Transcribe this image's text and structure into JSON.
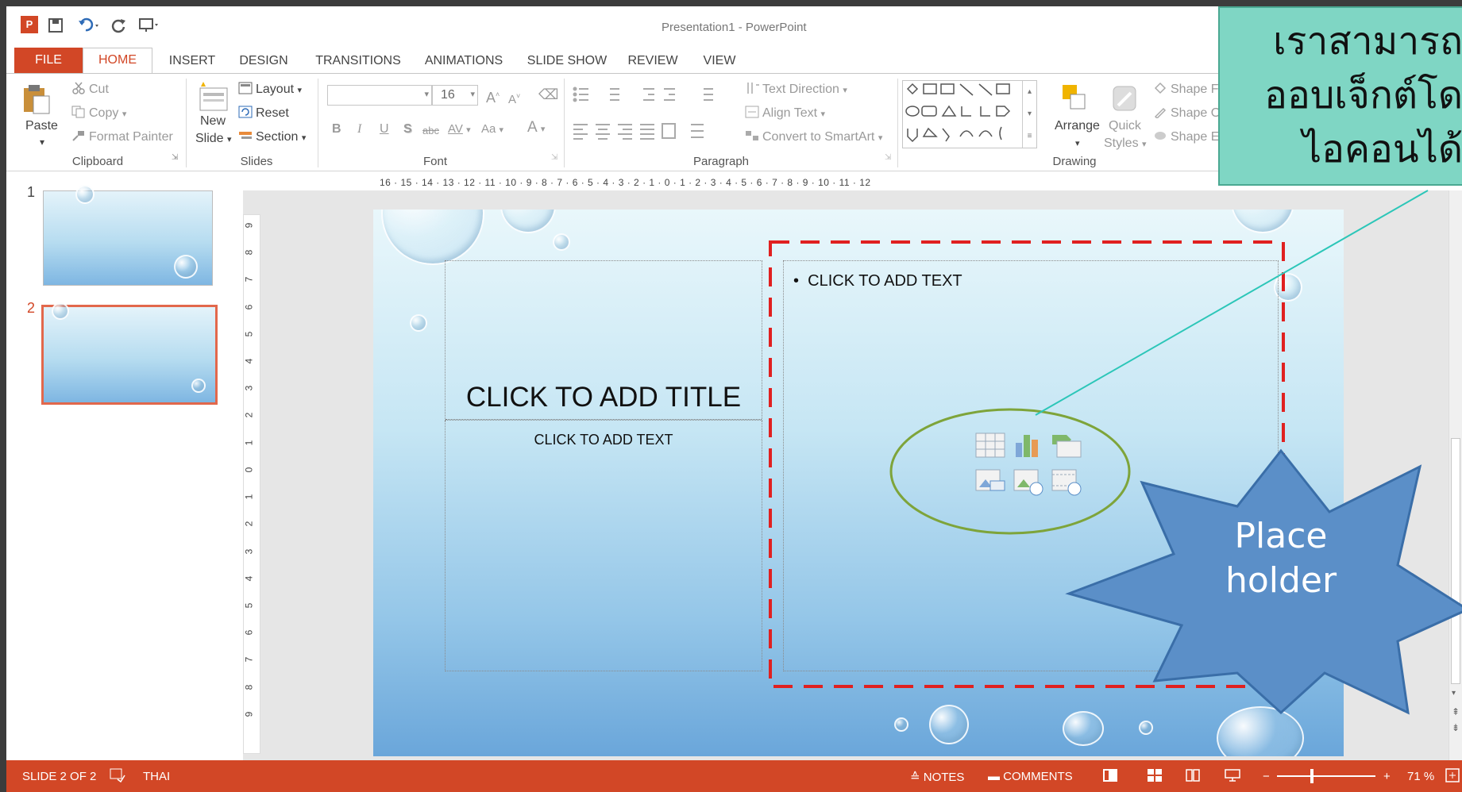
{
  "titlebar": {
    "title": "Presentation1 - PowerPoint"
  },
  "tabs": [
    "FILE",
    "HOME",
    "INSERT",
    "DESIGN",
    "TRANSITIONS",
    "ANIMATIONS",
    "SLIDE SHOW",
    "REVIEW",
    "VIEW"
  ],
  "ribbon": {
    "clipboard": {
      "paste": "Paste",
      "cut": "Cut",
      "copy": "Copy",
      "format_painter": "Format Painter",
      "label": "Clipboard"
    },
    "slides": {
      "new_slide_line1": "New",
      "new_slide_line2": "Slide",
      "layout": "Layout",
      "reset": "Reset",
      "section": "Section",
      "label": "Slides"
    },
    "font": {
      "size": "16",
      "bold": "B",
      "italic": "I",
      "underline": "U",
      "shadow": "S",
      "strikethrough": "abc",
      "spacing": "AV",
      "change_case": "Aa",
      "font_color": "A",
      "label": "Font"
    },
    "paragraph": {
      "text_direction": "Text Direction",
      "align_text": "Align Text",
      "convert_smartart": "Convert to SmartArt",
      "label": "Paragraph"
    },
    "drawing": {
      "arrange": "Arrange",
      "quick_styles_line1": "Quick",
      "quick_styles_line2": "Styles",
      "shape_fill": "Shape Fill",
      "shape_outline": "Shape Outline",
      "shape_effects": "Shape Effects",
      "label": "Drawing"
    }
  },
  "ruler": {
    "horizontal": "16 · 15 · 14 · 13 · 12 · 11 · 10 · 9 · 8 · 7 · 6 · 5 · 4 · 3 · 2 · 1 · 0 · 1 · 2 · 3 · 4 · 5 · 6 · 7 · 8 · 9 · 10 · 11 · 12",
    "vertical": [
      "9",
      "8",
      "7",
      "6",
      "5",
      "4",
      "3",
      "2",
      "1",
      "0",
      "1",
      "2",
      "3",
      "4",
      "5",
      "6",
      "7",
      "8",
      "9"
    ]
  },
  "thumbnails": [
    {
      "number": "1"
    },
    {
      "number": "2"
    }
  ],
  "slide": {
    "title_placeholder": "CLICK TO ADD TITLE",
    "subtitle_placeholder": "CLICK TO ADD TEXT",
    "content_placeholder": "CLICK TO ADD TEXT",
    "bullet": "•"
  },
  "callout": {
    "line1": "เราสามารถ",
    "line2": "ออบเจ็กต์โด",
    "line3": "ไอคอนได้"
  },
  "star_label": {
    "line1": "Place",
    "line2": "holder"
  },
  "statusbar": {
    "slide_info": "SLIDE 2 OF 2",
    "language": "THAI",
    "notes": "NOTES",
    "comments": "COMMENTS",
    "zoom": "71 %"
  },
  "colors": {
    "accent": "#d24726",
    "callout_fill": "#7fd6c4",
    "dash": "#e02020",
    "star_fill": "#5b8fc8",
    "ellipse": "#7ea43a"
  }
}
